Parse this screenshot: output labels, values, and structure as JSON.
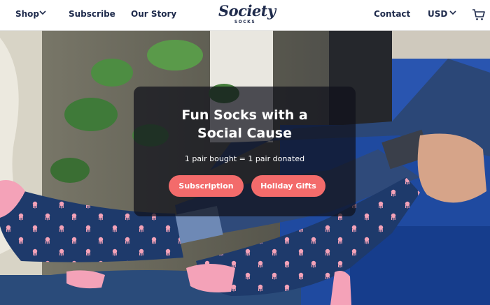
{
  "nav": {
    "shop": "Shop",
    "subscribe": "Subscribe",
    "our_story": "Our Story",
    "logo_word": "Society",
    "logo_sub": "SOCKS",
    "contact": "Contact",
    "currency": "USD"
  },
  "hero": {
    "headline_line1": "Fun Socks with a",
    "headline_line2": "Social Cause",
    "tagline": "1 pair bought = 1 pair donated",
    "btn_subscription": "Subscription",
    "btn_holiday": "Holiday Gifts"
  },
  "colors": {
    "brand_navy": "#1f2b4c",
    "button_coral": "#f36b6b",
    "sock_navy": "#1e3a6b",
    "sock_pink": "#f4a2b8"
  },
  "icons": [
    "chevron-down-icon",
    "cart-icon"
  ]
}
